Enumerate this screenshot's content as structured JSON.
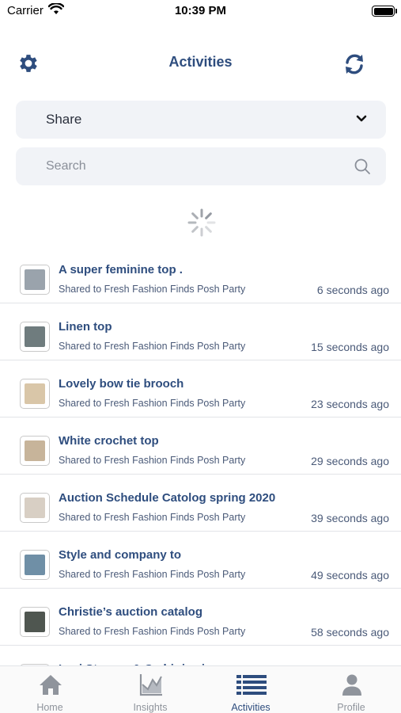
{
  "status_bar": {
    "carrier": "Carrier",
    "time": "10:39 PM"
  },
  "header": {
    "title": "Activities",
    "left_icon": "gear-icon",
    "right_icon": "refresh-icon"
  },
  "filter": {
    "selected": "Share"
  },
  "search": {
    "placeholder": "Search",
    "value": ""
  },
  "activities": [
    {
      "title": "A super feminine top  .",
      "subtitle": "Shared to Fresh Fashion Finds Posh Party",
      "time": "6 seconds ago",
      "thumb_color": "#9aa3ac"
    },
    {
      "title": "Linen top",
      "subtitle": "Shared to Fresh Fashion Finds Posh Party",
      "time": "15 seconds ago",
      "thumb_color": "#6f7c7e"
    },
    {
      "title": "Lovely bow tie brooch",
      "subtitle": "Shared to Fresh Fashion Finds Posh Party",
      "time": "23 seconds ago",
      "thumb_color": "#d9c6a8"
    },
    {
      "title": "White crochet top",
      "subtitle": "Shared to Fresh Fashion Finds Posh Party",
      "time": "29 seconds ago",
      "thumb_color": "#c7b49a"
    },
    {
      "title": "Auction Schedule Catolog spring 2020",
      "subtitle": "Shared to Fresh Fashion Finds Posh Party",
      "time": "39 seconds ago",
      "thumb_color": "#d8cfc4"
    },
    {
      "title": "Style and company to",
      "subtitle": "Shared to Fresh Fashion Finds Posh Party",
      "time": "49 seconds ago",
      "thumb_color": "#6f8fa6"
    },
    {
      "title": "Christie’s auction catalog",
      "subtitle": "Shared to Fresh Fashion Finds Posh Party",
      "time": "58 seconds ago",
      "thumb_color": "#4f5650"
    },
    {
      "title": "Levi Strauss & Co hi rise jeans",
      "subtitle": "",
      "time": "",
      "thumb_color": "#a08a72"
    }
  ],
  "tabs": [
    {
      "label": "Home",
      "icon": "home-icon",
      "active": false
    },
    {
      "label": "Insights",
      "icon": "chart-icon",
      "active": false
    },
    {
      "label": "Activities",
      "icon": "list-icon",
      "active": true
    },
    {
      "label": "Profile",
      "icon": "person-icon",
      "active": false
    }
  ],
  "colors": {
    "accent": "#2e4d7e",
    "field_bg": "#f1f3f7",
    "inactive_tab": "#8f949c"
  }
}
